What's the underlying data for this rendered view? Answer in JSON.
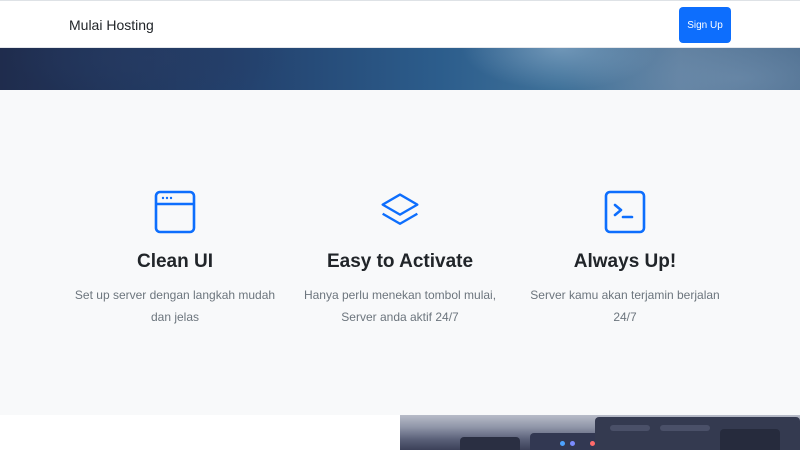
{
  "navbar": {
    "brand": "Mulai Hosting",
    "signup_label": "Sign Up"
  },
  "features": [
    {
      "icon": "browser-window-icon",
      "title": "Clean UI",
      "description": "Set up server dengan langkah mudah dan jelas"
    },
    {
      "icon": "layers-icon",
      "title": "Easy to Activate",
      "description": "Hanya perlu menekan tombol mulai, Server anda aktif 24/7"
    },
    {
      "icon": "terminal-icon",
      "title": "Always Up!",
      "description": "Server kamu akan terjamin berjalan 24/7"
    }
  ],
  "colors": {
    "primary": "#0d6efd",
    "section_bg": "#f8f9fa",
    "muted_text": "#6c757d"
  }
}
